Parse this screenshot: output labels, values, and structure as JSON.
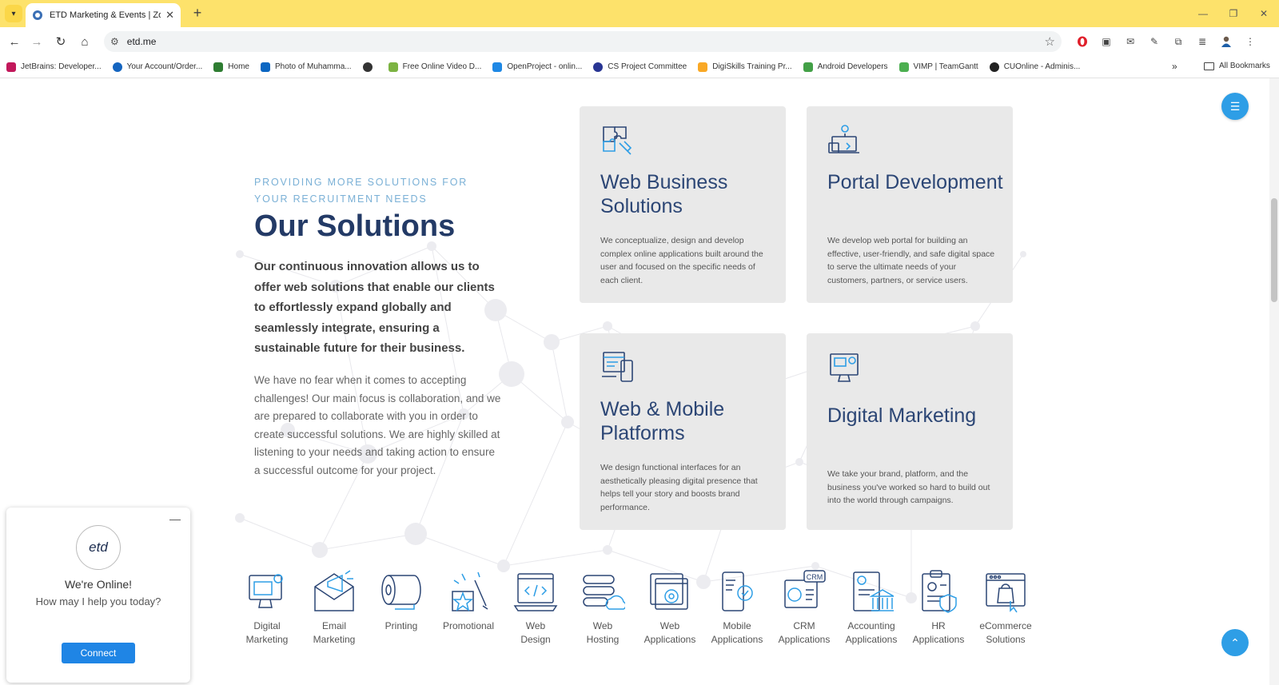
{
  "browser": {
    "tab_title": "ETD Marketing & Events | Zoho",
    "url": "etd.me",
    "bookmarks": [
      "JetBrains: Developer...",
      "Your Account/Order...",
      "Home",
      "Photo of Muhamma...",
      "",
      "Free Online Video D...",
      "OpenProject - onlin...",
      "CS Project Committee",
      "DigiSkills Training Pr...",
      "Android Developers",
      "VIMP | TeamGantt",
      "CUOnline - Adminis..."
    ],
    "bookmarks_more": "»",
    "all_bookmarks": "All Bookmarks"
  },
  "page": {
    "eyebrow": "PROVIDING MORE SOLUTIONS FOR YOUR RECRUITMENT NEEDS",
    "heading": "Our Solutions",
    "lead": "Our continuous innovation allows us to offer web solutions that enable our clients to effortlessly expand globally and seamlessly integrate, ensuring a sustainable future for their business.",
    "body": "We have no fear when it comes to accepting challenges! Our main focus is collaboration, and we are prepared to collaborate with you in order to create successful solutions. We are highly skilled at listening to your needs and taking action to ensure a successful outcome for your project.",
    "cards": [
      {
        "title": "Web Business Solutions",
        "icon": "puzzle-icon",
        "desc": "We conceptualize, design and develop complex online applications built around the user and focused on the specific needs of each client."
      },
      {
        "title": "Portal Development",
        "icon": "portal-gear-icon",
        "desc": "We develop web portal for building an effective, user-friendly, and safe digital space to serve the ultimate needs of your customers, partners, or service users."
      },
      {
        "title": "Web & Mobile Platforms",
        "icon": "web-mobile-icon",
        "desc": "We design functional interfaces for an aesthetically pleasing digital presence that helps tell your story and boosts brand performance."
      },
      {
        "title": "Digital Marketing",
        "icon": "digital-marketing-icon",
        "desc": "We take your brand, platform, and the business you've worked so hard to build out into the world through campaigns."
      }
    ],
    "services": [
      {
        "label": "Digital\nMarketing",
        "icon": "digital-marketing-icon"
      },
      {
        "label": "Email\nMarketing",
        "icon": "email-megaphone-icon"
      },
      {
        "label": "Printing",
        "icon": "paper-roll-icon"
      },
      {
        "label": "Promotional",
        "icon": "promotional-icon"
      },
      {
        "label": "Web\nDesign",
        "icon": "web-design-icon"
      },
      {
        "label": "Web\nHosting",
        "icon": "server-cloud-icon"
      },
      {
        "label": "Web\nApplications",
        "icon": "web-app-gear-icon"
      },
      {
        "label": "Mobile\nApplications",
        "icon": "mobile-gear-icon"
      },
      {
        "label": "CRM\nApplications",
        "icon": "crm-icon"
      },
      {
        "label": "Accounting\nApplications",
        "icon": "accounting-icon"
      },
      {
        "label": "HR\nApplications",
        "icon": "hr-clipboard-icon"
      },
      {
        "label": "eCommerce\nSolutions",
        "icon": "ecommerce-bag-icon"
      }
    ]
  },
  "chat": {
    "logo_text": "etd",
    "title": "We're Online!",
    "subtitle": "How may I help you today?",
    "button": "Connect"
  },
  "colors": {
    "accent": "#2e9ee6",
    "heading": "#233a66",
    "card_title": "#2c4675",
    "tab_bar": "#fde26b"
  }
}
